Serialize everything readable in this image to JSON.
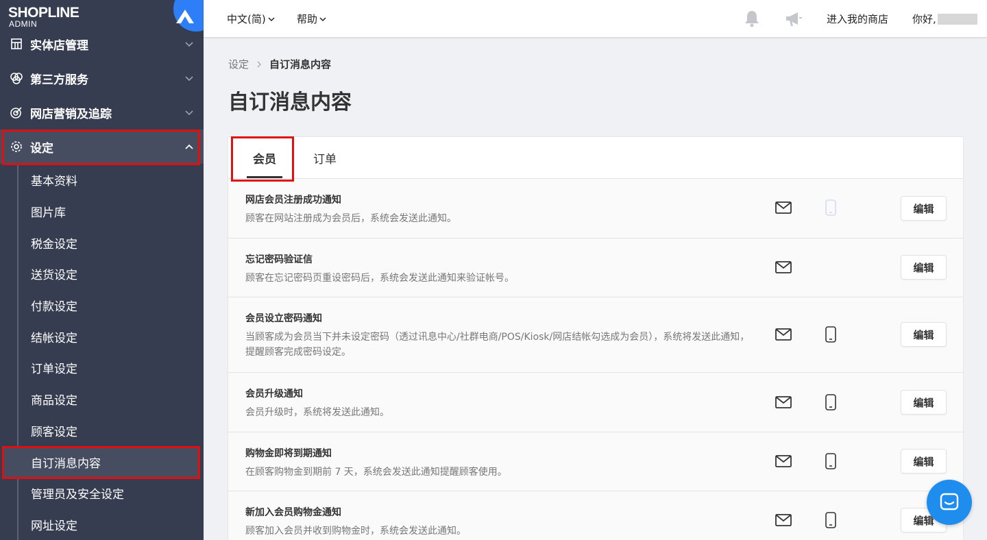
{
  "brand": {
    "logo": "SHOPLINE",
    "sub": "ADMIN",
    "accent": "#2d7ef7"
  },
  "sidebar": {
    "items": [
      {
        "label": "实体店管理",
        "icon": "store-icon"
      },
      {
        "label": "第三方服务",
        "icon": "services-icon"
      },
      {
        "label": "网店营销及追踪",
        "icon": "target-icon"
      },
      {
        "label": "设定",
        "icon": "gear-icon"
      }
    ],
    "sub_items": [
      "基本资料",
      "图片库",
      "税金设定",
      "送货设定",
      "付款设定",
      "结帐设定",
      "订单设定",
      "商品设定",
      "顾客设定",
      "自订消息内容",
      "管理员及安全设定",
      "网址设定"
    ]
  },
  "topbar": {
    "language": "中文(简)",
    "help": "帮助",
    "enter_store": "进入我的商店",
    "greeting": "你好,"
  },
  "breadcrumb": {
    "parent": "设定",
    "current": "自订消息内容"
  },
  "page_title": "自订消息内容",
  "tabs": [
    {
      "label": "会员"
    },
    {
      "label": "订单"
    }
  ],
  "edit_label": "编辑",
  "notifications": [
    {
      "title": "网店会员注册成功通知",
      "desc": "顾客在网站注册成为会员后，系统会发送此通知。",
      "email": true,
      "sms": "disabled"
    },
    {
      "title": "忘记密码验证信",
      "desc": "顾客在忘记密码页重设密码后，系统会发送此通知来验证帐号。",
      "email": true,
      "sms": "none"
    },
    {
      "title": "会员设立密码通知",
      "desc": "当顾客成为会员当下并未设定密码（透过讯息中心/社群电商/POS/Kiosk/网店结帐勾选成为会员），系统将发送此通知，提醒顾客完成密码设定。",
      "email": true,
      "sms": "enabled"
    },
    {
      "title": "会员升级通知",
      "desc": "会员升级时，系统将发送此通知。",
      "email": true,
      "sms": "enabled"
    },
    {
      "title": "购物金即将到期通知",
      "desc": "在顾客购物金到期前 7 天，系统会发送此通知提醒顾客使用。",
      "email": true,
      "sms": "enabled"
    },
    {
      "title": "新加入会员购物金通知",
      "desc": "顾客加入会员并收到购物金时，系统会发送此通知。",
      "email": true,
      "sms": "enabled"
    }
  ],
  "colors": {
    "sidebar_bg": "#373d50",
    "highlight": "#e01010",
    "chat": "#1f8ded"
  }
}
